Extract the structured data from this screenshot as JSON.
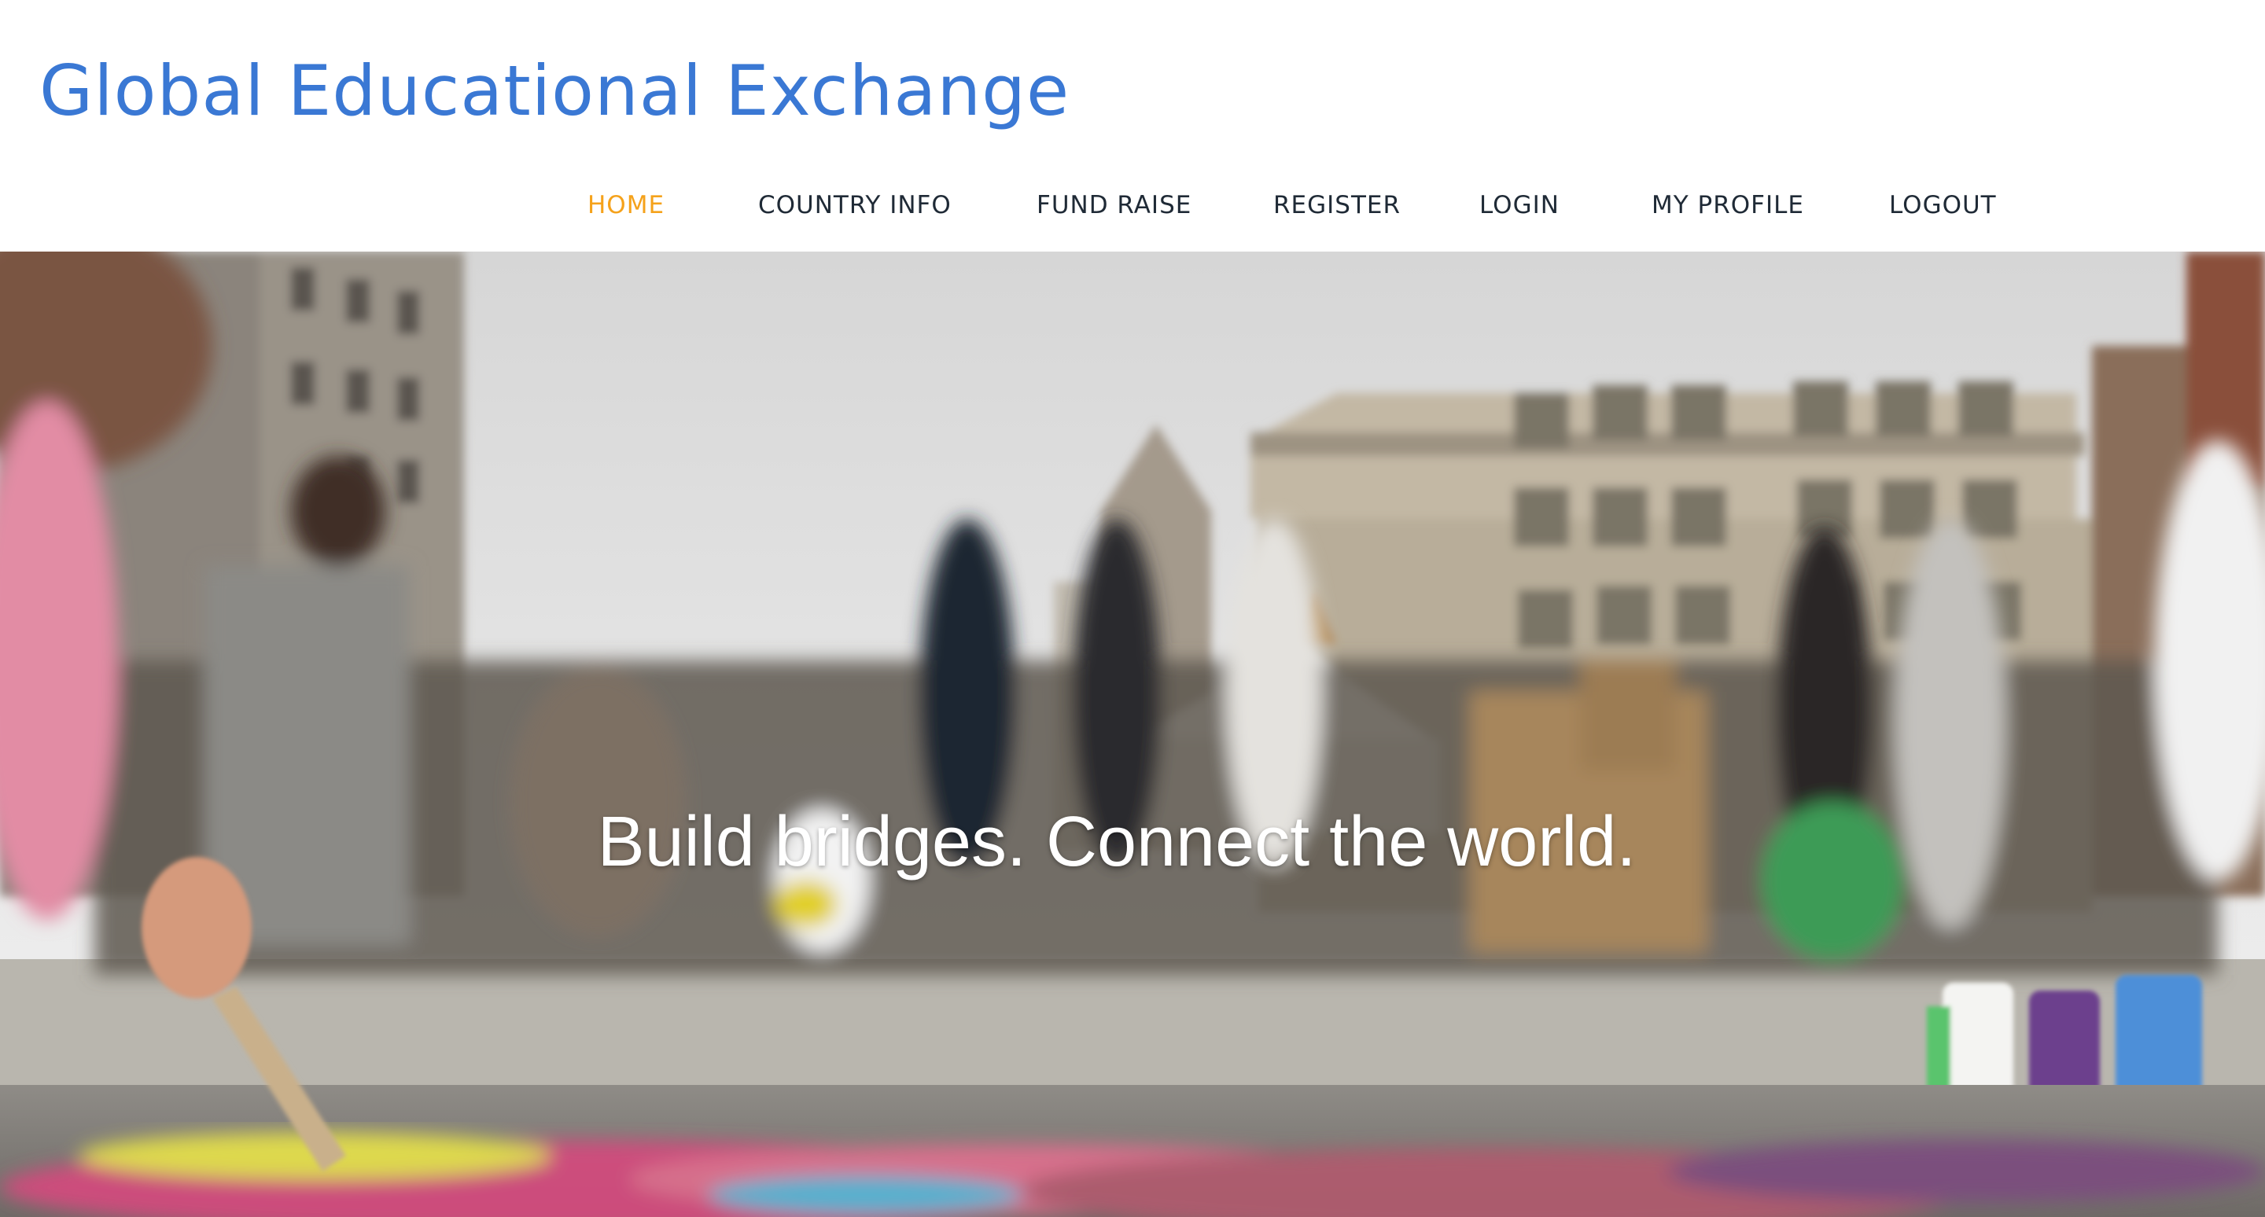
{
  "site": {
    "title": "Global Educational Exchange",
    "title_color": "#3a78d4"
  },
  "nav": {
    "active_color": "#f5a21b",
    "text_color": "#1f2a36",
    "items": [
      {
        "label": "HOME",
        "active": true
      },
      {
        "label": "COUNTRY INFO",
        "active": false
      },
      {
        "label": "FUND RAISE",
        "active": false
      },
      {
        "label": "REGISTER",
        "active": false
      },
      {
        "label": "LOGIN",
        "active": false
      },
      {
        "label": "MY PROFILE",
        "active": false
      },
      {
        "label": "LOGOUT",
        "active": false
      }
    ]
  },
  "hero": {
    "tagline": "Build bridges. Connect the world."
  }
}
